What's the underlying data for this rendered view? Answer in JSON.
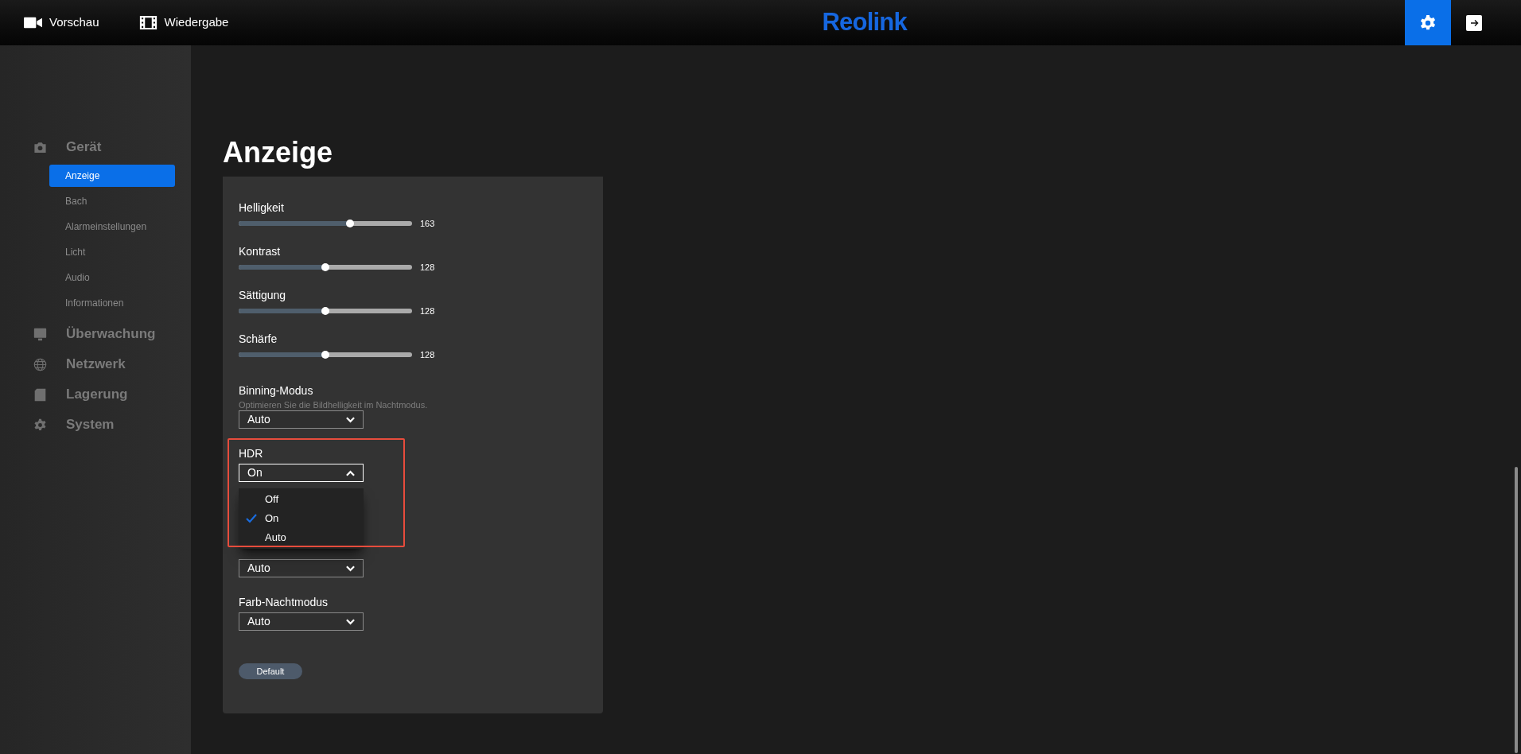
{
  "topbar": {
    "nav": [
      {
        "label": "Vorschau"
      },
      {
        "label": "Wiedergabe"
      }
    ],
    "logo": "Reolink",
    "actions": [
      {
        "kind": "settings",
        "selected": true
      },
      {
        "kind": "logout",
        "selected": false
      }
    ]
  },
  "sidebar": {
    "groups": [
      {
        "label": "Gerät",
        "items": [
          {
            "label": "Anzeige",
            "selected": true
          },
          {
            "label": "Bach",
            "selected": false
          },
          {
            "label": "Alarmeinstellungen",
            "selected": false
          },
          {
            "label": "Licht",
            "selected": false
          },
          {
            "label": "Audio",
            "selected": false
          },
          {
            "label": "Informationen",
            "selected": false
          }
        ]
      },
      {
        "label": "Überwachung"
      },
      {
        "label": "Netzwerk"
      },
      {
        "label": "Lagerung"
      },
      {
        "label": "System"
      }
    ]
  },
  "page": {
    "title": "Anzeige",
    "settings": [
      {
        "kind": "slider",
        "label": "Helligkeit",
        "level": 0.64,
        "reading": "163"
      },
      {
        "kind": "slider",
        "label": "Kontrast",
        "level": 0.5,
        "reading": "128"
      },
      {
        "kind": "slider",
        "label": "Sättigung",
        "level": 0.5,
        "reading": "128"
      },
      {
        "kind": "slider",
        "label": "Schärfe",
        "level": 0.5,
        "reading": "128"
      },
      {
        "kind": "select",
        "label": "Binning-Modus",
        "description": "Optimieren Sie die Bildhelligkeit im Nachtmodus.",
        "value": "Auto",
        "expanded": false
      },
      {
        "kind": "select",
        "label": "HDR",
        "value": "On",
        "expanded": true,
        "highlighted": true,
        "options": [
          {
            "label": "Off",
            "selected": false
          },
          {
            "label": "On",
            "selected": true
          },
          {
            "label": "Auto",
            "selected": false
          }
        ]
      },
      {
        "kind": "select",
        "value": "Auto",
        "expanded": false
      },
      {
        "kind": "select",
        "label": "Farb-Nachtmodus",
        "value": "Auto",
        "expanded": false
      }
    ],
    "default_button": "Default"
  }
}
